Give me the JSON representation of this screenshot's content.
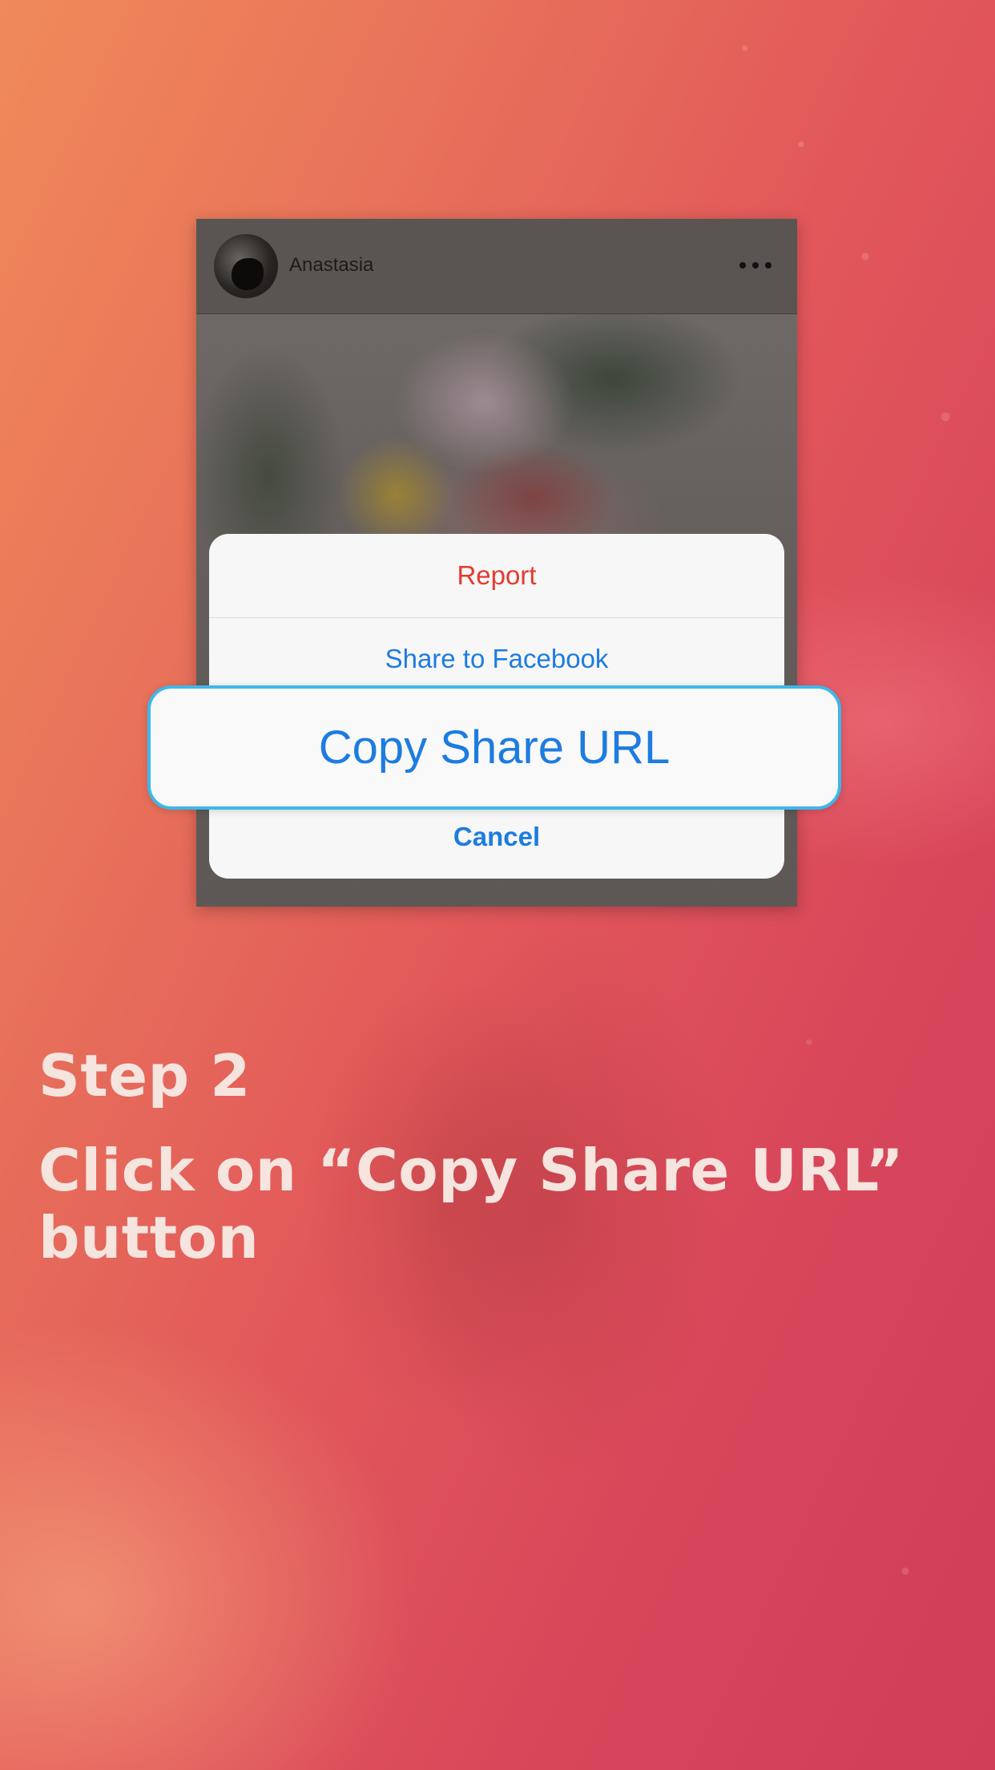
{
  "post": {
    "username": "Anastasia"
  },
  "action_sheet": {
    "report_label": "Report",
    "share_facebook_label": "Share to Facebook",
    "copy_share_url_label": "Copy Share URL",
    "cancel_label": "Cancel"
  },
  "instructions": {
    "step_title": "Step 2",
    "step_description": "Click on “Copy Share URL” button"
  },
  "colors": {
    "report_red": "#e8392f",
    "ios_blue": "#1d7ce0",
    "highlight_border": "#3db7ea",
    "text_light": "#f6e4de"
  },
  "icons": {
    "more": "more-dots-icon",
    "avatar": "avatar"
  }
}
